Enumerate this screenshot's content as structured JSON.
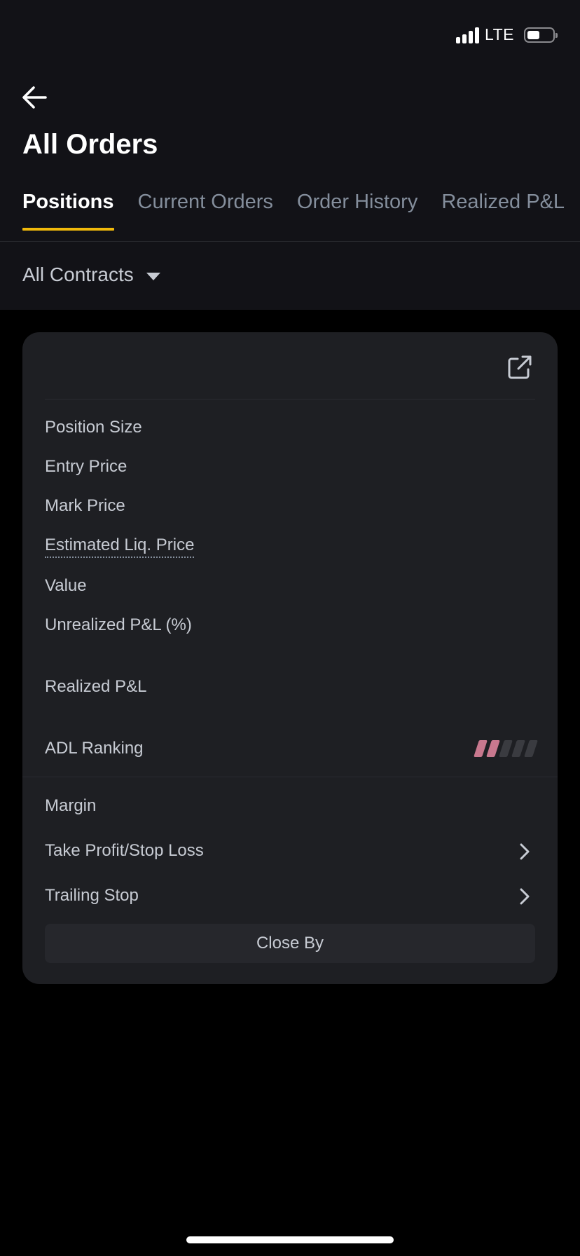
{
  "status_bar": {
    "network": "LTE",
    "signal_icon": "signal-bars-icon",
    "battery_icon": "battery-icon",
    "battery_level": 0.4
  },
  "header": {
    "back_icon": "arrow-left-icon",
    "title": "All Orders"
  },
  "tabs": [
    {
      "label": "Positions",
      "active": true
    },
    {
      "label": "Current Orders",
      "active": false
    },
    {
      "label": "Order History",
      "active": false
    },
    {
      "label": "Realized P&L",
      "active": false
    }
  ],
  "filter": {
    "label": "All Contracts",
    "icon": "caret-down-icon"
  },
  "position_card": {
    "share_icon": "external-share-icon",
    "rows": {
      "position_size": "Position Size",
      "entry_price": "Entry Price",
      "mark_price": "Mark Price",
      "estimated_liq_price": "Estimated Liq. Price",
      "value": "Value",
      "unrealized_pnl": "Unrealized P&L (%)",
      "realized_pnl": "Realized P&L",
      "adl_ranking": "ADL Ranking"
    },
    "adl_level": 2,
    "adl_max": 5,
    "adl_active_color": "#C8788E",
    "margin": "Margin",
    "take_profit_stop_loss": "Take Profit/Stop Loss",
    "trailing_stop": "Trailing Stop",
    "chevron_icon": "chevron-right-icon",
    "close_by": "Close By"
  },
  "colors": {
    "accent": "#F0B90B",
    "header_bg": "#121217",
    "card_bg": "#1E1F23",
    "page_bg": "#000000"
  }
}
